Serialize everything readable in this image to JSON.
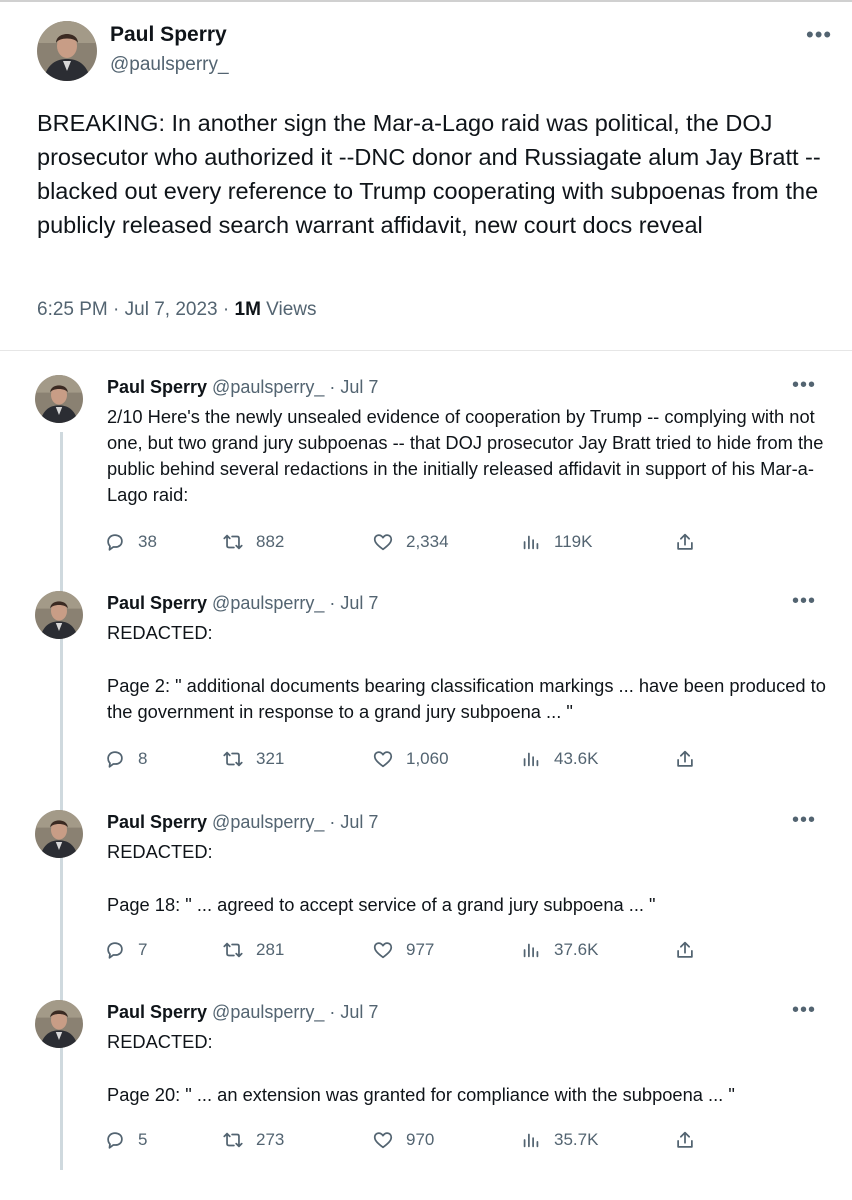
{
  "main_tweet": {
    "name": "Paul Sperry",
    "handle": "@paulsperry_",
    "more": "•••",
    "text": "BREAKING: In another sign the Mar-a-Lago raid was political, the DOJ prosecutor who authorized it --DNC donor and Russiagate alum Jay Bratt --blacked out every reference to Trump cooperating with subpoenas from the publicly released search warrant affidavit, new court docs reveal",
    "time": "6:25 PM · Jul 7, 2023 · ",
    "views_count": "1M",
    "views_label": " Views"
  },
  "replies": [
    {
      "name": "Paul Sperry",
      "handle_date": " @paulsperry_ · Jul 7",
      "more": "•••",
      "line1": "2/10 Here's the newly unsealed evidence of cooperation by Trump -- complying with not one, but two grand jury subpoenas -- that DOJ prosecutor Jay Bratt tried to hide from the public behind several redactions in the initially released affidavit in support of his Mar-a-Lago raid:",
      "line2": "",
      "replies": "38",
      "retweets": "882",
      "likes": "2,334",
      "views": "119K"
    },
    {
      "name": "Paul Sperry",
      "handle_date": " @paulsperry_ · Jul 7",
      "more": "•••",
      "line1": "REDACTED:",
      "line2": "Page 2: \" additional documents bearing classification markings ... have been produced to the government in response to a grand jury subpoena ... \"",
      "replies": "8",
      "retweets": "321",
      "likes": "1,060",
      "views": "43.6K"
    },
    {
      "name": "Paul Sperry",
      "handle_date": " @paulsperry_ · Jul 7",
      "more": "•••",
      "line1": "REDACTED:",
      "line2": "Page 18: \" ... agreed to accept service of a grand jury subpoena ... \"",
      "replies": "7",
      "retweets": "281",
      "likes": "977",
      "views": "37.6K"
    },
    {
      "name": "Paul Sperry",
      "handle_date": " @paulsperry_ · Jul 7",
      "more": "•••",
      "line1": "REDACTED:",
      "line2": "Page 20: \" ... an extension was granted for compliance with the subpoena ... \"",
      "replies": "5",
      "retweets": "273",
      "likes": "970",
      "views": "35.7K"
    }
  ],
  "icons": [
    "avatar",
    "more-icon",
    "reply-icon",
    "retweet-icon",
    "like-icon",
    "views-icon",
    "share-icon"
  ],
  "colors": {
    "text": "#0f1419",
    "secondary": "#536471",
    "thread_line": "#cfd9de"
  }
}
